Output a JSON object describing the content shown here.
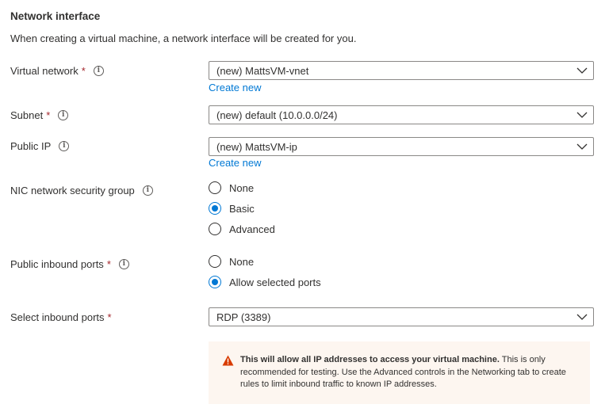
{
  "section": {
    "title": "Network interface",
    "description": "When creating a virtual machine, a network interface will be created for you."
  },
  "virtual_network": {
    "label": "Virtual network",
    "required": "*",
    "value": "(new) MattsVM-vnet",
    "create_new": "Create new"
  },
  "subnet": {
    "label": "Subnet",
    "required": "*",
    "value": "(new) default (10.0.0.0/24)"
  },
  "public_ip": {
    "label": "Public IP",
    "value": "(new) MattsVM-ip",
    "create_new": "Create new"
  },
  "nic_nsg": {
    "label": "NIC network security group",
    "options": [
      "None",
      "Basic",
      "Advanced"
    ],
    "selected": "Basic"
  },
  "public_inbound_ports": {
    "label": "Public inbound ports",
    "required": "*",
    "options": [
      "None",
      "Allow selected ports"
    ],
    "selected": "Allow selected ports"
  },
  "select_inbound_ports": {
    "label": "Select inbound ports",
    "required": "*",
    "value": "RDP (3389)"
  },
  "warning": {
    "bold": "This will allow all IP addresses to access your virtual machine.",
    "text": "This is only recommended for testing.  Use the Advanced controls in the Networking tab to create rules to limit inbound traffic to known IP addresses.",
    "icon": "warning-icon",
    "icon_color": "#d83b01"
  },
  "icons": {
    "info": "info-icon",
    "chevron": "chevron-down-icon"
  },
  "colors": {
    "accent": "#0078d4",
    "required": "#a4262c",
    "warning_bg": "#fdf6f0"
  }
}
